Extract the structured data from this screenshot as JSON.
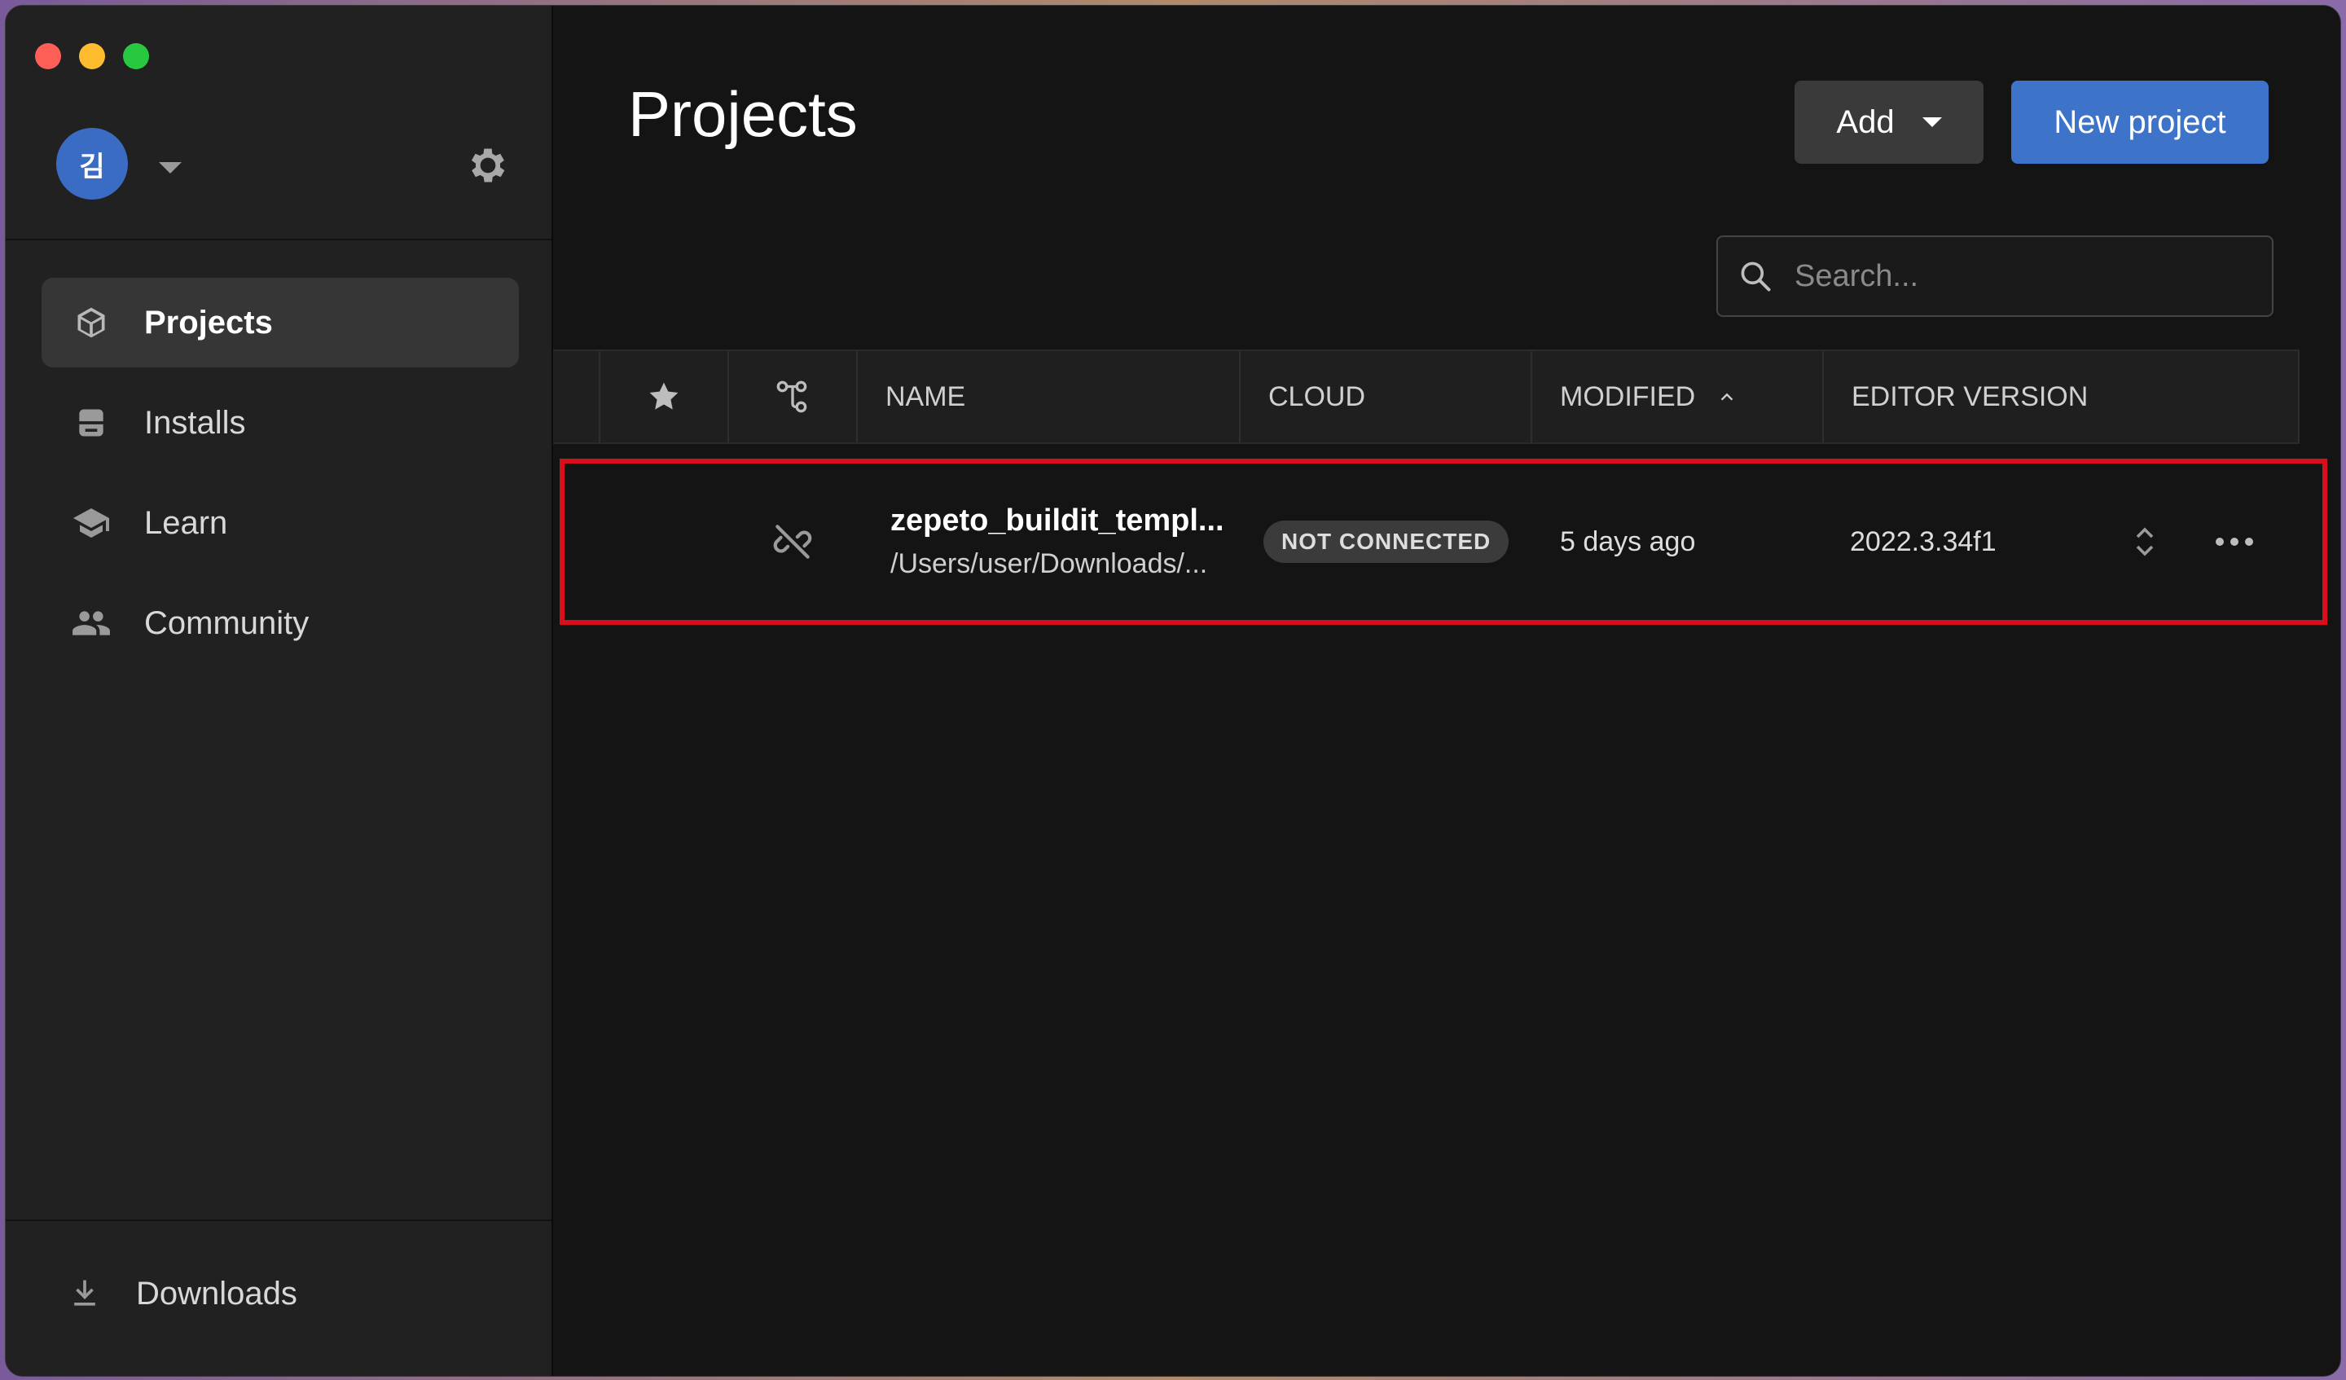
{
  "sidebar": {
    "avatar_initial": "김",
    "nav": [
      {
        "label": "Projects",
        "icon": "cube-icon",
        "active": true
      },
      {
        "label": "Installs",
        "icon": "installs-icon",
        "active": false
      },
      {
        "label": "Learn",
        "icon": "graduation-cap-icon",
        "active": false
      },
      {
        "label": "Community",
        "icon": "people-icon",
        "active": false
      }
    ],
    "downloads_label": "Downloads"
  },
  "header": {
    "title": "Projects",
    "add_label": "Add",
    "new_project_label": "New project"
  },
  "search": {
    "placeholder": "Search..."
  },
  "table": {
    "columns": {
      "name": "NAME",
      "cloud": "CLOUD",
      "modified": "MODIFIED",
      "editor_version": "EDITOR VERSION"
    },
    "sort": {
      "column": "MODIFIED",
      "direction": "ascending"
    },
    "rows": [
      {
        "name": "zepeto_buildit_templ...",
        "path": "/Users/user/Downloads/...",
        "cloud": "NOT CONNECTED",
        "modified": "5 days ago",
        "editor_version": "2022.3.34f1"
      }
    ]
  },
  "colors": {
    "accent": "#3d74c9",
    "highlight_border": "#d80f1b",
    "background": "#141414",
    "sidebar": "#212121"
  }
}
